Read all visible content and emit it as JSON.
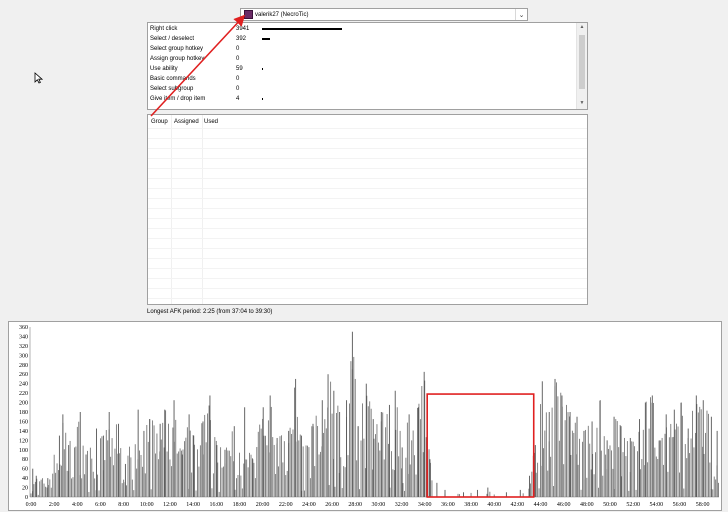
{
  "player": {
    "name": "valerik27 (NecroTic)",
    "color": "#6a2a66"
  },
  "actions": [
    {
      "label": "Right click",
      "count": "3941",
      "value": 3941
    },
    {
      "label": "Select / deselect",
      "count": "392",
      "value": 392
    },
    {
      "label": "Select group hotkey",
      "count": "0",
      "value": 0
    },
    {
      "label": "Assign group hotkey",
      "count": "0",
      "value": 0
    },
    {
      "label": "Use ability",
      "count": "59",
      "value": 59
    },
    {
      "label": "Basic commands",
      "count": "0",
      "value": 0
    },
    {
      "label": "Select subgroup",
      "count": "0",
      "value": 0
    },
    {
      "label": "Give item / drop item",
      "count": "4",
      "value": 4
    }
  ],
  "group_table": {
    "columns": [
      "Group",
      "Assigned",
      "Used"
    ]
  },
  "afk": {
    "text": "Longest AFK period: 2:25 (from 37:04 to 39:30)"
  },
  "highlight": {
    "color": "#e02020",
    "start_minute": 34.3,
    "end_minute": 43.5,
    "value": 218
  },
  "chart_data": {
    "type": "bar",
    "x_ticks": [
      "0:00",
      "2:00",
      "4:00",
      "6:00",
      "8:00",
      "10:00",
      "12:00",
      "14:00",
      "16:00",
      "18:00",
      "20:00",
      "22:00",
      "24:00",
      "26:00",
      "28:00",
      "30:00",
      "32:00",
      "34:00",
      "36:00",
      "38:00",
      "40:00",
      "42:00",
      "44:00",
      "46:00",
      "48:00",
      "50:00",
      "52:00",
      "54:00",
      "56:00",
      "58:00"
    ],
    "y_ticks": [
      0,
      20,
      40,
      60,
      80,
      100,
      120,
      140,
      160,
      180,
      200,
      220,
      240,
      260,
      280,
      300,
      320,
      340,
      360
    ],
    "ylim": [
      0,
      360
    ],
    "xlim_minutes": [
      0,
      59.5
    ],
    "bar_color": "#707070",
    "peaks": [
      [
        0.2,
        60
      ],
      [
        0.5,
        45
      ],
      [
        1.5,
        40
      ],
      [
        2.5,
        130
      ],
      [
        2.8,
        175
      ],
      [
        3.3,
        110
      ],
      [
        4.3,
        180
      ],
      [
        4.8,
        90
      ],
      [
        5.7,
        145
      ],
      [
        6.3,
        130
      ],
      [
        6.8,
        180
      ],
      [
        7.6,
        155
      ],
      [
        8.2,
        70
      ],
      [
        9.3,
        185
      ],
      [
        9.8,
        140
      ],
      [
        10.3,
        165
      ],
      [
        11.2,
        155
      ],
      [
        11.6,
        185
      ],
      [
        12.4,
        205
      ],
      [
        13.1,
        90
      ],
      [
        13.7,
        175
      ],
      [
        14.1,
        130
      ],
      [
        14.9,
        160
      ],
      [
        15.5,
        215
      ],
      [
        16.1,
        110
      ],
      [
        16.8,
        100
      ],
      [
        17.6,
        150
      ],
      [
        18.5,
        190
      ],
      [
        19.2,
        80
      ],
      [
        20.1,
        190
      ],
      [
        20.7,
        215
      ],
      [
        21.3,
        125
      ],
      [
        22.3,
        140
      ],
      [
        22.9,
        250
      ],
      [
        23.4,
        130
      ],
      [
        24.4,
        155
      ],
      [
        25.2,
        205
      ],
      [
        25.7,
        260
      ],
      [
        26.2,
        225
      ],
      [
        26.7,
        180
      ],
      [
        27.3,
        205
      ],
      [
        27.8,
        350
      ],
      [
        28.3,
        150
      ],
      [
        29.0,
        240
      ],
      [
        29.6,
        165
      ],
      [
        30.3,
        180
      ],
      [
        31.0,
        195
      ],
      [
        31.5,
        225
      ],
      [
        32.1,
        105
      ],
      [
        32.7,
        175
      ],
      [
        33.5,
        190
      ],
      [
        34.0,
        265
      ],
      [
        34.5,
        80
      ],
      [
        35.1,
        30
      ],
      [
        35.8,
        15
      ],
      [
        37.4,
        10
      ],
      [
        38.6,
        15
      ],
      [
        39.5,
        20
      ],
      [
        41.1,
        10
      ],
      [
        42.3,
        15
      ],
      [
        43.1,
        45
      ],
      [
        43.6,
        110
      ],
      [
        44.2,
        245
      ],
      [
        44.8,
        180
      ],
      [
        45.3,
        250
      ],
      [
        45.9,
        215
      ],
      [
        46.6,
        180
      ],
      [
        47.2,
        170
      ],
      [
        47.8,
        140
      ],
      [
        48.5,
        160
      ],
      [
        49.2,
        205
      ],
      [
        49.8,
        120
      ],
      [
        50.4,
        170
      ],
      [
        51.0,
        150
      ],
      [
        51.8,
        125
      ],
      [
        52.6,
        165
      ],
      [
        53.1,
        200
      ],
      [
        53.7,
        215
      ],
      [
        54.3,
        120
      ],
      [
        54.9,
        175
      ],
      [
        55.6,
        185
      ],
      [
        56.2,
        200
      ],
      [
        56.8,
        145
      ],
      [
        57.5,
        215
      ],
      [
        58.1,
        205
      ],
      [
        58.8,
        170
      ],
      [
        59.3,
        140
      ]
    ]
  }
}
